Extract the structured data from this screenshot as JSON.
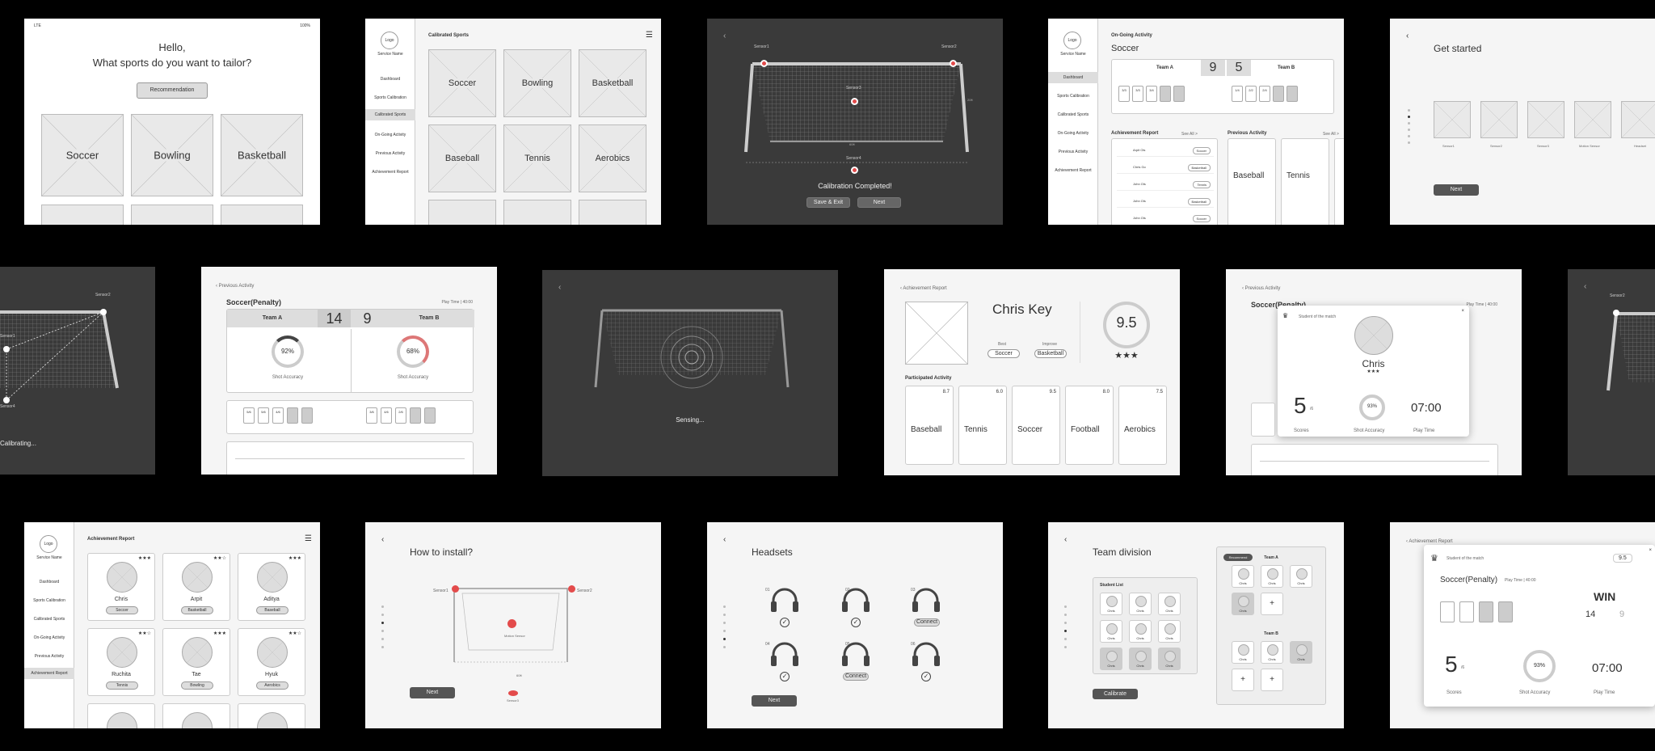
{
  "s1": {
    "status_left": "LTE",
    "status_right": "100%",
    "hello": "Hello,",
    "question": "What sports do you want to tailor?",
    "recommend": "Recommendation",
    "sports": [
      "Soccer",
      "Bowling",
      "Basketball"
    ]
  },
  "s2": {
    "logo": "Logo",
    "service": "Service Name",
    "menu": [
      "Dashboard",
      "Sports Calibration",
      "Calibrated Sports",
      "On-Going Activity",
      "Previous Activity",
      "Achievement Report"
    ],
    "title": "Calibrated Sports",
    "sports": [
      "Soccer",
      "Bowling",
      "Basketball",
      "Baseball",
      "Tennis",
      "Aerobics"
    ]
  },
  "s3": {
    "sensor1": "Sensor1",
    "sensor2": "Sensor2",
    "sensor3": "Sensor3",
    "sensor4": "Sensor4",
    "dim_w": "60ft",
    "dim_h": "20ft",
    "done": "Calibration Completed!",
    "save": "Save & Exit",
    "next": "Next"
  },
  "s4": {
    "logo": "Logo",
    "service": "Service Name",
    "menu": [
      "Dashboard",
      "Sports Calibration",
      "Calibrated Sports",
      "On-Going Activity",
      "Previous Activity",
      "Achievement Report"
    ],
    "title": "On-Going Activity",
    "sport": "Soccer",
    "teamA": "Team A",
    "teamB": "Team B",
    "scoreA": "9",
    "scoreB": "5",
    "boxesA": [
      "3/3",
      "3/3",
      "3/4"
    ],
    "boxesB": [
      "1/4",
      "2/2",
      "2/4"
    ],
    "achv": "Achievement Report",
    "prev": "Previous Activity",
    "seeall": "See All >",
    "names": [
      "Arpit Ols",
      "Chris Go",
      "John Ols",
      "John Ols",
      "John Ols"
    ],
    "tags": [
      "Soccer",
      "Basketball",
      "Tennis",
      "Basketball",
      "Soccer"
    ],
    "prevSports": [
      "Baseball",
      "Tennis"
    ]
  },
  "s5": {
    "title": "Get started",
    "sensors": [
      "Sensor1",
      "Sensor2",
      "Sensor3",
      "Motion Sensor",
      "Headset"
    ],
    "next": "Next"
  },
  "s6": {
    "sensor1": "Sensor1",
    "sensor2": "Sensor2",
    "sensor4": "Sensor4",
    "calibrating": "Calibrating..."
  },
  "s7": {
    "back": "Previous Activity",
    "sport": "Soccer(Penalty)",
    "play": "Play Time | 40:00",
    "teamA": "Team A",
    "teamB": "Team B",
    "scoreA": "14",
    "scoreB": "9",
    "accA": "92%",
    "accB": "68%",
    "accLabel": "Shot Accuracy",
    "boxesA": [
      "5/6",
      "5/6",
      "4/6"
    ],
    "boxesB": [
      "3/6",
      "4/6",
      "2/6"
    ]
  },
  "s8": {
    "sensing": "Sensing..."
  },
  "s9": {
    "back": "Achievement Report",
    "name": "Chris Key",
    "best": "Best",
    "improve": "Improve",
    "bestTag": "Soccer",
    "improveTag": "Basketball",
    "score": "9.5",
    "stars": "★★★",
    "participated": "Participated Activity",
    "acts": [
      {
        "name": "Football",
        "score": "8.0"
      },
      {
        "name": "Tennis",
        "score": "6.0"
      },
      {
        "name": "Soccer",
        "score": "9.5"
      },
      {
        "name": "Baseball",
        "score": "8.7"
      },
      {
        "name": "Aerobics",
        "score": "7.5"
      }
    ]
  },
  "s10": {
    "back": "Previous Activity",
    "sport": "Soccer(Penalty)",
    "play": "Play Time | 40:00",
    "badge": "Student of the match",
    "name": "Chris",
    "stars": "★★★",
    "score": "5",
    "scoreSub": "/6",
    "acc": "93%",
    "time": "07:00",
    "lScores": "Scores",
    "lAcc": "Shot Accuracy",
    "lTime": "Play Time"
  },
  "s11": {
    "sensor2": "Sensor2"
  },
  "s12": {
    "logo": "Logo",
    "service": "Service Name",
    "menu": [
      "Dashboard",
      "Sports Calibration",
      "Calibrated Sports",
      "On-Going Activity",
      "Previous Activity",
      "Achievement Report"
    ],
    "title": "Achievement Report",
    "people": [
      {
        "name": "Chris",
        "tag": "Soccer"
      },
      {
        "name": "Arpit",
        "tag": "Basketball"
      },
      {
        "name": "Aditya",
        "tag": "Baseball"
      },
      {
        "name": "Ruchita",
        "tag": "Tennis"
      },
      {
        "name": "Tae",
        "tag": "Bowling"
      },
      {
        "name": "Hyuk",
        "tag": "Aerobics"
      }
    ]
  },
  "s13": {
    "title": "How to install?",
    "sensor1": "Sensor1",
    "sensor2": "Sensor2",
    "motion": "Motion Sensor",
    "sensor3": "Sensor3",
    "dim": "60ft",
    "next": "Next"
  },
  "s14": {
    "title": "Headsets",
    "nums": [
      "01",
      "02",
      "03",
      "04",
      "05",
      "06"
    ],
    "connect": "Connect",
    "next": "Next"
  },
  "s15": {
    "title": "Team division",
    "list": "Student List",
    "recommend": "Recommend",
    "teamA": "Team A",
    "teamB": "Team B",
    "chris": "Chris",
    "calibrate": "Calibrate"
  },
  "s16": {
    "back": "Achievement Report",
    "badge": "Student of the match",
    "score95": "9.5",
    "sport": "Soccer(Penalty)",
    "play": "Play Time | 40:00",
    "win": "WIN",
    "w14": "14",
    "w9": "9",
    "score": "5",
    "scoreSub": "/6",
    "acc": "93%",
    "time": "07:00",
    "lScores": "Scores",
    "lAcc": "Shot Accuracy",
    "lTime": "Play Time"
  }
}
